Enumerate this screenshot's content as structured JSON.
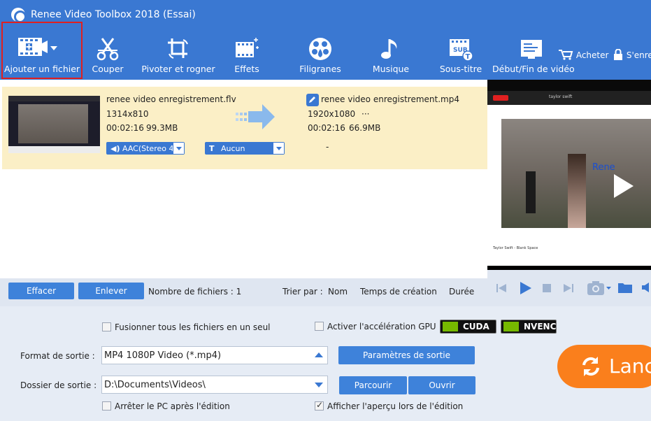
{
  "window": {
    "title": "Renee Video Toolbox 2018 (Essai)"
  },
  "toolbar": {
    "tools": [
      {
        "label": "Ajouter un fichier",
        "icon": "film-add-icon"
      },
      {
        "label": "Couper",
        "icon": "scissors-icon"
      },
      {
        "label": "Pivoter et rogner",
        "icon": "rotate-crop-icon"
      },
      {
        "label": "Effets",
        "icon": "effects-icon"
      },
      {
        "label": "Filigranes",
        "icon": "watermark-icon"
      },
      {
        "label": "Musique",
        "icon": "music-icon"
      },
      {
        "label": "Sous-titre",
        "icon": "subtitle-icon"
      },
      {
        "label": "Début/Fin de vidéo",
        "icon": "intro-outro-icon"
      }
    ],
    "buy_label": "Acheter",
    "register_label": "S'enreg"
  },
  "file": {
    "source_name": "renee video enregistrement.flv",
    "source_resolution": "1314x810",
    "source_duration": "00:02:16",
    "source_size": "99.3MB",
    "output_name": "renee video enregistrement.mp4",
    "output_resolution": "1920x1080",
    "output_extra": "···",
    "output_duration": "00:02:16",
    "output_size": "66.9MB",
    "audio_track": "AAC(Stereo 4",
    "subtitle": "Aucun",
    "dash": "-"
  },
  "preview": {
    "yt_title": "taylor swift",
    "caption": "Taylor Swift - Blank Space",
    "overlay_text": "Rene"
  },
  "listbar": {
    "clear_label": "Effacer",
    "remove_label": "Enlever",
    "file_count": "Nombre de fichiers : 1",
    "sort_label": "Trier par :",
    "sort_name": "Nom",
    "sort_created": "Temps de création",
    "sort_duration": "Durée"
  },
  "settings": {
    "merge_label": "Fusionner tous les fichiers en un seul",
    "merge_checked": false,
    "gpu_label": "Activer l'accélération GPU",
    "gpu_checked": false,
    "cuda": "CUDA",
    "nvenc": "NVENC",
    "format_label": "Format de sortie :",
    "format_value": "MP4 1080P Video (*.mp4)",
    "output_settings_label": "Paramètres de sortie",
    "folder_label": "Dossier de sortie :",
    "folder_value": "D:\\Documents\\Videos\\",
    "browse_label": "Parcourir",
    "open_label": "Ouvrir",
    "shutdown_label": "Arrêter le PC après l'édition",
    "shutdown_checked": false,
    "preview_label": "Afficher l'aperçu lors de l'édition",
    "preview_checked": true,
    "launch_label": "Lanc"
  },
  "colors": {
    "accent": "#3a78d2",
    "launch": "#fa7f1c",
    "highlight_row": "#fbefc6"
  }
}
